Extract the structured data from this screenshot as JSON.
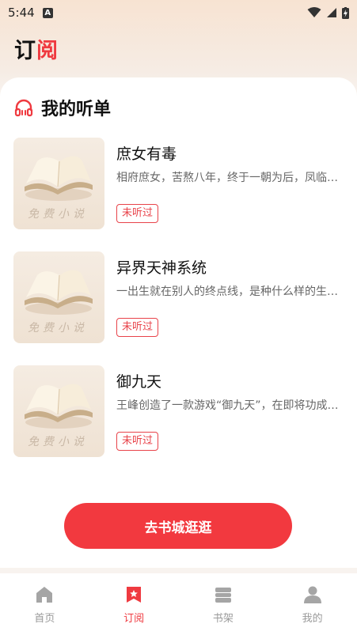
{
  "status_bar": {
    "time": "5:44",
    "notification_icon_letter": "A"
  },
  "header": {
    "title_main": "订",
    "title_accent": "阅",
    "accent_color": "#ef3a40"
  },
  "section": {
    "title": "我的听单",
    "icon": "headphones-icon"
  },
  "books": [
    {
      "title": "庶女有毒",
      "description": "相府庶女，苦熬八年，终于一朝为后，凤临天下...",
      "badge": "未听过",
      "cover_text": "免费小说"
    },
    {
      "title": "异界天神系统",
      "description": "一出生就在别人的终点线，是种什么样的生活体验...",
      "badge": "未听过",
      "cover_text": "免费小说"
    },
    {
      "title": "御九天",
      "description": "王峰创造了一款游戏“御九天”，在即将功成名就之时...",
      "badge": "未听过",
      "cover_text": "免费小说"
    }
  ],
  "cta": {
    "label": "去书城逛逛"
  },
  "tabs": [
    {
      "label": "首页",
      "icon": "home-icon",
      "active": false
    },
    {
      "label": "订阅",
      "icon": "bookmark-icon",
      "active": true
    },
    {
      "label": "书架",
      "icon": "bookshelf-icon",
      "active": false
    },
    {
      "label": "我的",
      "icon": "profile-icon",
      "active": false
    }
  ]
}
